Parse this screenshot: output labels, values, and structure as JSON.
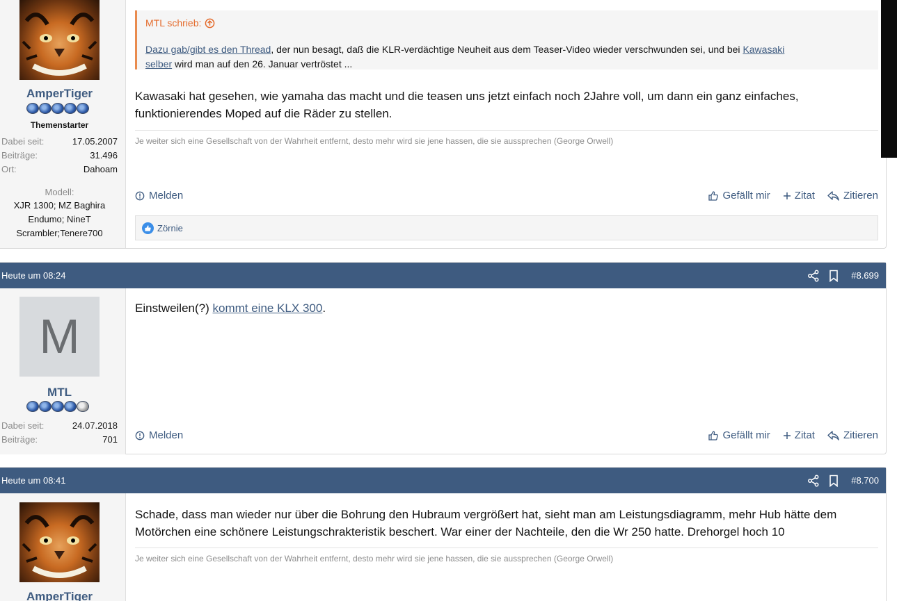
{
  "posts": [
    {
      "user": {
        "name": "AmperTiger",
        "role": "Themenstarter",
        "stats": [
          {
            "k": "Dabei seit:",
            "v": "17.05.2007"
          },
          {
            "k": "Beiträge:",
            "v": "31.496"
          },
          {
            "k": "Ort:",
            "v": "Dahoam"
          }
        ],
        "model_label": "Modell:",
        "model_lines": [
          "XJR 1300; MZ Baghira",
          "Endumo; NineT",
          "Scrambler;Tenere700"
        ]
      },
      "quote": {
        "author": "MTL schrieb:",
        "link1": "Dazu gab/gibt es den Thread",
        "text1": ", der nun besagt, daß die KLR-verdächtige Neuheit aus dem Teaser-Video wieder verschwunden sei, und bei ",
        "link2a": "Kawasaki",
        "link2b": "selber",
        "text2": " wird man auf den 26. Januar vertröstet ..."
      },
      "body": [
        "Kawasaki hat gesehen, wie yamaha das macht und die teasen uns jetzt einfach noch 2Jahre voll, um dann ein ganz einfaches,",
        "funktionierendes Moped auf die Räder zu stellen."
      ],
      "signature": "Je weiter sich eine Gesellschaft von der Wahrheit entfernt, desto mehr wird sie jene hassen, die sie aussprechen (George Orwell)",
      "reaction_user": "Zörnie"
    },
    {
      "time": "Heute um 08:24",
      "number": "#8.699",
      "user": {
        "name": "MTL",
        "avatar_letter": "M",
        "stats": [
          {
            "k": "Dabei seit:",
            "v": "24.07.2018"
          },
          {
            "k": "Beiträge:",
            "v": "701"
          }
        ]
      },
      "body_pre": "Einstweilen(?) ",
      "body_link": "kommt eine KLX 300",
      "body_post": "."
    },
    {
      "time": "Heute um 08:41",
      "number": "#8.700",
      "user": {
        "name": "AmperTiger"
      },
      "body": [
        "Schade, dass man wieder nur über die Bohrung den Hubraum vergrößert hat, sieht man am Leistungsdiagramm, mehr Hub hätte dem",
        "Motörchen eine schönere Leistungschrakteristik beschert. War einer der Nachteile, den die Wr 250 hatte. Drehorgel hoch 10"
      ],
      "signature": "Je weiter sich eine Gesellschaft von der Wahrheit entfernt, desto mehr wird sie jene hassen, die sie aussprechen (George Orwell)"
    }
  ],
  "actions": {
    "report": "Melden",
    "like": "Gefällt mir",
    "quote": "Zitat",
    "reply": "Zitieren"
  },
  "icons": {
    "share": "share-icon",
    "bookmark": "bookmark-icon",
    "report": "report-icon",
    "like": "thumbs-up-icon",
    "plus": "plus-icon",
    "reply": "reply-icon",
    "quote_up": "arrow-up-circle-icon"
  },
  "colors": {
    "header": "#3e5b80",
    "quote_accent": "#e46b2c",
    "link": "#3e5b80"
  }
}
